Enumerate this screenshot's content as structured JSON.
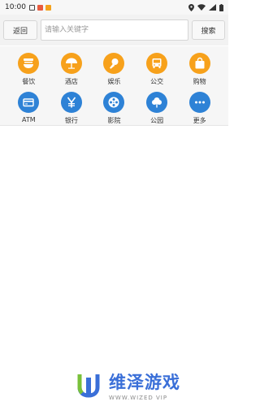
{
  "status_bar": {
    "time": "10:00"
  },
  "search_bar": {
    "back_label": "返回",
    "search_placeholder": "请输入关键字",
    "search_label": "搜索"
  },
  "categories": {
    "row1": [
      {
        "label": "餐饮",
        "icon": "restaurant-icon",
        "color": "#f7a11b"
      },
      {
        "label": "酒店",
        "icon": "hotel-icon",
        "color": "#f7a11b"
      },
      {
        "label": "娱乐",
        "icon": "microphone-icon",
        "color": "#f7a11b"
      },
      {
        "label": "公交",
        "icon": "bus-icon",
        "color": "#f7a11b"
      },
      {
        "label": "购物",
        "icon": "shopping-bag-icon",
        "color": "#f7a11b"
      }
    ],
    "row2": [
      {
        "label": "ATM",
        "icon": "atm-card-icon",
        "color": "#2e82d6"
      },
      {
        "label": "银行",
        "icon": "bank-yuan-icon",
        "color": "#2e82d6"
      },
      {
        "label": "影院",
        "icon": "film-reel-icon",
        "color": "#2e82d6"
      },
      {
        "label": "公园",
        "icon": "tree-icon",
        "color": "#2e82d6"
      },
      {
        "label": "更多",
        "icon": "more-dots-icon",
        "color": "#2e82d6"
      }
    ]
  },
  "watermark": {
    "title": "维泽游戏",
    "subtitle": "WWW.WIZED VIP"
  }
}
